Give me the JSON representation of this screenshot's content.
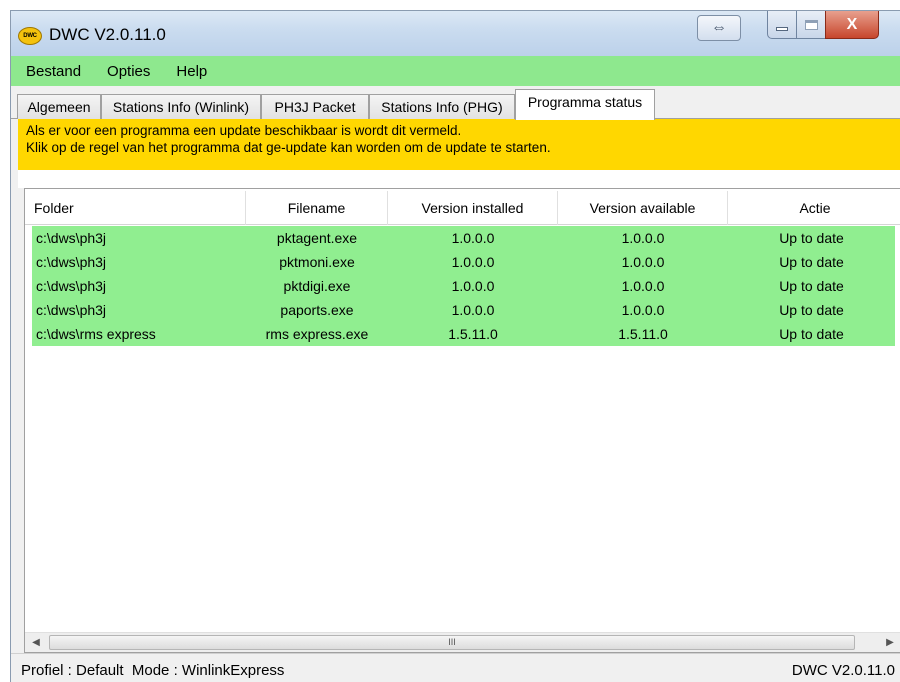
{
  "window": {
    "title": "DWC V2.0.11.0",
    "icon_label": "DWC"
  },
  "titlebar_buttons": {
    "snap_icon": "resize-horizontal-icon",
    "minimize_icon": "minimize-icon",
    "maximize_icon": "maximize-icon",
    "close_glyph": "X"
  },
  "menu": {
    "items": [
      "Bestand",
      "Opties",
      "Help"
    ]
  },
  "tabs": [
    {
      "label": "Algemeen"
    },
    {
      "label": "Stations Info (Winlink)"
    },
    {
      "label": "PH3J Packet"
    },
    {
      "label": "Stations Info (PHG)"
    },
    {
      "label": "Programma status"
    }
  ],
  "active_tab": "Programma status",
  "info": {
    "line1": "Als er voor een programma een update beschikbaar is wordt dit vermeld.",
    "line2": "Klik op de regel van het programma dat ge-update kan worden om de update te starten."
  },
  "table": {
    "columns": [
      "Folder",
      "Filename",
      "Version installed",
      "Version available",
      "Actie"
    ],
    "rows": [
      [
        "c:\\dws\\ph3j",
        "pktagent.exe",
        "1.0.0.0",
        "1.0.0.0",
        "Up to date"
      ],
      [
        "c:\\dws\\ph3j",
        "pktmoni.exe",
        "1.0.0.0",
        "1.0.0.0",
        "Up to date"
      ],
      [
        "c:\\dws\\ph3j",
        "pktdigi.exe",
        "1.0.0.0",
        "1.0.0.0",
        "Up to date"
      ],
      [
        "c:\\dws\\ph3j",
        "paports.exe",
        "1.0.0.0",
        "1.0.0.0",
        "Up to date"
      ],
      [
        "c:\\dws\\rms express",
        "rms express.exe",
        "1.5.11.0",
        "1.5.11.0",
        "Up to date"
      ]
    ],
    "row_color": "#90ee90"
  },
  "scrollbar": {
    "left_arrow": "◀",
    "right_arrow": "▶",
    "grip": "III"
  },
  "status": {
    "left": "Profiel : Default  Mode : WinlinkExpress",
    "right": "DWC V2.0.11.0"
  },
  "colors": {
    "menubar": "#8ee88e",
    "info_panel": "#ffd700",
    "row_highlight": "#90ee90"
  }
}
